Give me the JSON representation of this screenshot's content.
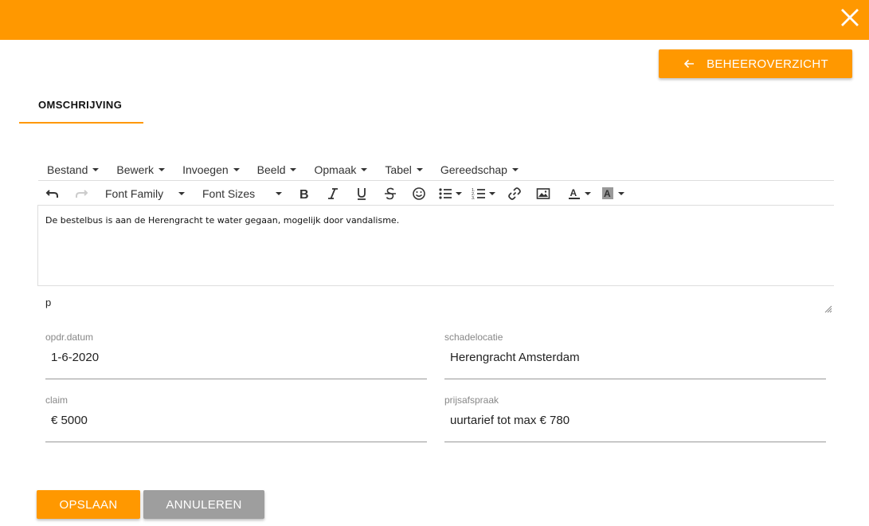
{
  "header": {
    "close_icon": "close-icon",
    "bar_color": "#ff9800"
  },
  "back_button": {
    "label": "BEHEEROVERZICHT",
    "icon": "arrow-left-icon"
  },
  "tab": {
    "label": "OMSCHRIJVING"
  },
  "editor": {
    "menu": [
      "Bestand",
      "Bewerk",
      "Invoegen",
      "Beeld",
      "Opmaak",
      "Tabel",
      "Gereedschap"
    ],
    "font_family": "Font Family",
    "font_sizes": "Font Sizes",
    "content": "De bestelbus is aan de Herengracht te water gegaan, mogelijk door vandalisme.",
    "path": "p"
  },
  "fields": {
    "opdr_datum": {
      "label": "opdr.datum",
      "value": "1-6-2020"
    },
    "schadelocatie": {
      "label": "schadelocatie",
      "value": "Herengracht Amsterdam"
    },
    "claim": {
      "label": "claim",
      "value": "€ 5000"
    },
    "prijsafspraak": {
      "label": "prijsafspraak",
      "value": "uurtarief tot max € 780"
    }
  },
  "actions": {
    "save_label": "OPSLAAN",
    "cancel_label": "ANNULEREN"
  },
  "colors": {
    "accent": "#ff9800",
    "secondary_button": "#9e9e9e"
  }
}
